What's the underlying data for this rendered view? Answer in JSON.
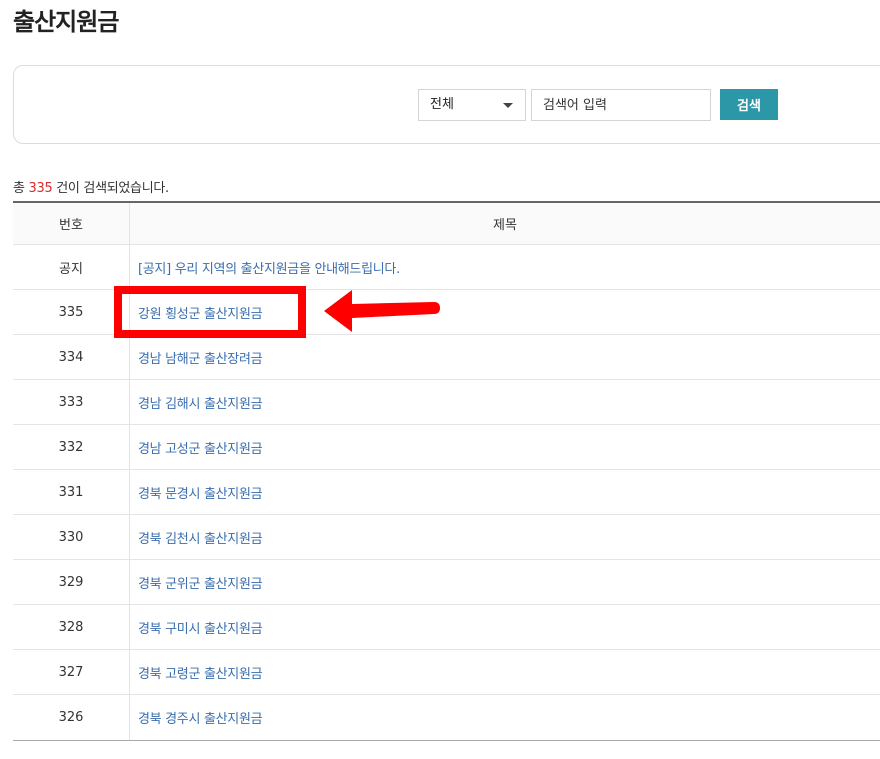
{
  "page": {
    "title": "출산지원금"
  },
  "search": {
    "select_value": "전체",
    "input_placeholder": "검색어 입력",
    "button_label": "검색"
  },
  "result": {
    "prefix": "총 ",
    "count": "335",
    "suffix": " 건이 검색되었습니다."
  },
  "table": {
    "headers": {
      "no": "번호",
      "title": "제목"
    },
    "rows": [
      {
        "no": "공지",
        "title": "[공지] 우리 지역의 출산지원금을 안내해드립니다."
      },
      {
        "no": "335",
        "title": "강원 횡성군 출산지원금"
      },
      {
        "no": "334",
        "title": "경남 남해군 출산장려금"
      },
      {
        "no": "333",
        "title": "경남 김해시 출산지원금"
      },
      {
        "no": "332",
        "title": "경남 고성군 출산지원금"
      },
      {
        "no": "331",
        "title": "경북 문경시 출산지원금"
      },
      {
        "no": "330",
        "title": "경북 김천시 출산지원금"
      },
      {
        "no": "329",
        "title": "경북 군위군 출산지원금"
      },
      {
        "no": "328",
        "title": "경북 구미시 출산지원금"
      },
      {
        "no": "327",
        "title": "경북 고령군 출산지원금"
      },
      {
        "no": "326",
        "title": "경북 경주시 출산지원금"
      }
    ]
  },
  "colors": {
    "accent": "#2c97a7",
    "link": "#3b6eae",
    "count": "#d9292b",
    "annotation": "#ff0000"
  },
  "icons": {
    "select_arrow": "caret-down-icon",
    "annotation_arrow": "arrow-left-icon"
  }
}
